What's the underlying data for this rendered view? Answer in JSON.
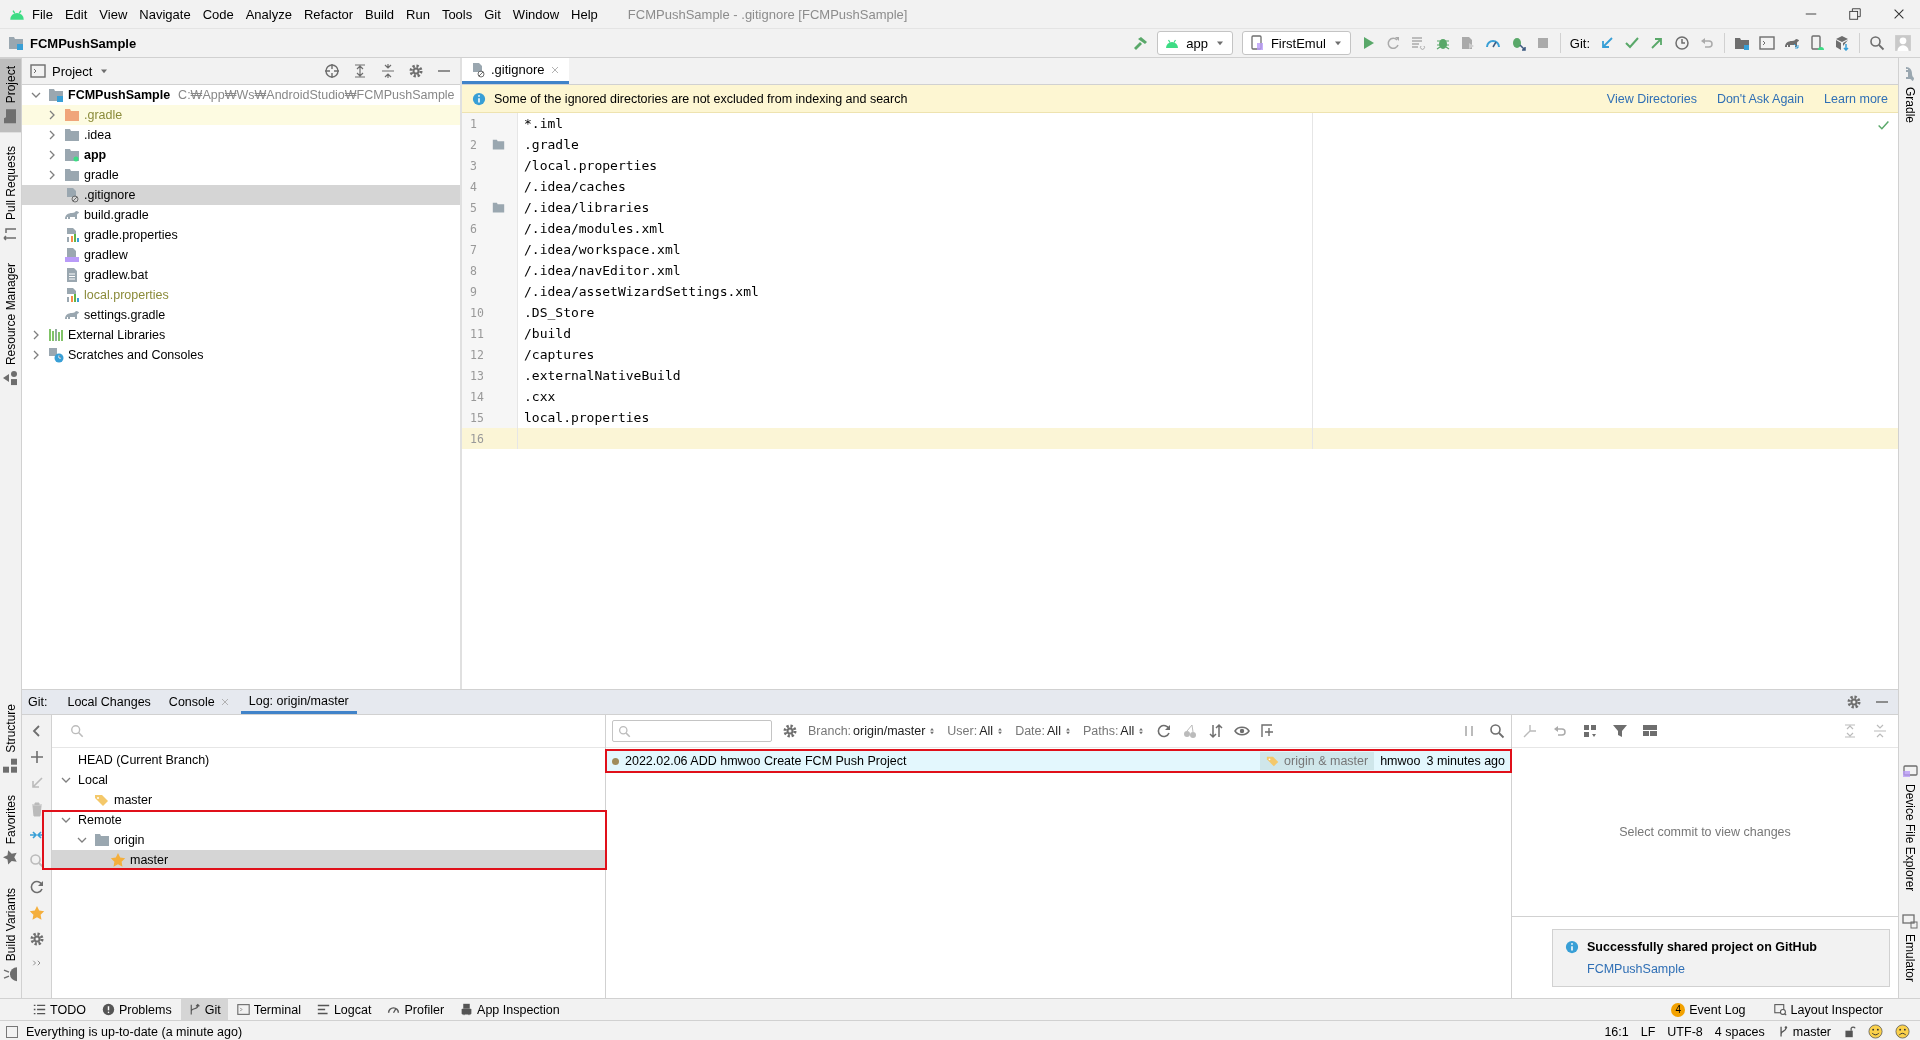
{
  "menu": {
    "items": [
      "File",
      "Edit",
      "View",
      "Navigate",
      "Code",
      "Analyze",
      "Refactor",
      "Build",
      "Run",
      "Tools",
      "Git",
      "Window",
      "Help"
    ],
    "title": "FCMPushSample - .gitignore [FCMPushSample]"
  },
  "navbar": {
    "project": "FCMPushSample",
    "run_config": "app",
    "device": "FirstEmul",
    "git_label": "Git:"
  },
  "left_strip": {
    "top": [
      {
        "label": "Project",
        "selected": true
      },
      {
        "label": "Pull Requests",
        "selected": false
      },
      {
        "label": "Resource Manager",
        "selected": false
      }
    ],
    "bottom": [
      {
        "label": "Structure",
        "selected": false
      },
      {
        "label": "Favorites",
        "selected": false
      },
      {
        "label": "Build Variants",
        "selected": false
      }
    ]
  },
  "right_strip": {
    "top": [
      {
        "label": "Gradle",
        "selected": false
      }
    ],
    "bottom": [
      {
        "label": "Device File Explorer",
        "selected": false
      },
      {
        "label": "Emulator",
        "selected": false
      }
    ]
  },
  "project_panel": {
    "title": "Project",
    "tree": [
      {
        "label": "FCMPushSample",
        "path": "C:₩App₩Ws₩AndroidStudio₩FCMPushSample",
        "kind": "project",
        "expanded": true,
        "selected": false,
        "ignored": false,
        "highlighted": false,
        "children": [
          {
            "label": ".gradle",
            "kind": "excluded-folder",
            "expanded": false,
            "selected": false,
            "ignored": true,
            "highlighted": true
          },
          {
            "label": ".idea",
            "kind": "folder",
            "expanded": false,
            "selected": false,
            "ignored": false,
            "highlighted": false
          },
          {
            "label": "app",
            "kind": "module",
            "expanded": false,
            "selected": false,
            "ignored": false,
            "highlighted": false
          },
          {
            "label": "gradle",
            "kind": "folder",
            "expanded": false,
            "selected": false,
            "ignored": false,
            "highlighted": false
          },
          {
            "label": ".gitignore",
            "kind": "ignore-file",
            "selected": true,
            "ignored": false,
            "highlighted": false
          },
          {
            "label": "build.gradle",
            "kind": "gradle",
            "selected": false,
            "ignored": false,
            "highlighted": false
          },
          {
            "label": "gradle.properties",
            "kind": "properties",
            "selected": false,
            "ignored": false,
            "highlighted": false
          },
          {
            "label": "gradlew",
            "kind": "shell",
            "selected": false,
            "ignored": false,
            "highlighted": false
          },
          {
            "label": "gradlew.bat",
            "kind": "text",
            "selected": false,
            "ignored": false,
            "highlighted": false
          },
          {
            "label": "local.properties",
            "kind": "properties",
            "selected": false,
            "ignored": true,
            "highlighted": false
          },
          {
            "label": "settings.gradle",
            "kind": "gradle",
            "selected": false,
            "ignored": false,
            "highlighted": false
          }
        ]
      },
      {
        "label": "External Libraries",
        "kind": "libraries",
        "expanded": false,
        "selected": false,
        "ignored": false,
        "highlighted": false
      },
      {
        "label": "Scratches and Consoles",
        "kind": "scratches",
        "expanded": false,
        "selected": false,
        "ignored": false,
        "highlighted": false
      }
    ]
  },
  "editor": {
    "tabs": [
      {
        "label": ".gitignore",
        "selected": true
      }
    ],
    "banner": {
      "message": "Some of the ignored directories are not excluded from indexing and search",
      "links": [
        "View Directories",
        "Don't Ask Again",
        "Learn more"
      ]
    },
    "lines": [
      {
        "number": "1",
        "text": "*.iml",
        "marker": false,
        "current": false
      },
      {
        "number": "2",
        "text": ".gradle",
        "marker": true,
        "current": false
      },
      {
        "number": "3",
        "text": "/local.properties",
        "marker": false,
        "current": false
      },
      {
        "number": "4",
        "text": "/.idea/caches",
        "marker": false,
        "current": false
      },
      {
        "number": "5",
        "text": "/.idea/libraries",
        "marker": true,
        "current": false
      },
      {
        "number": "6",
        "text": "/.idea/modules.xml",
        "marker": false,
        "current": false
      },
      {
        "number": "7",
        "text": "/.idea/workspace.xml",
        "marker": false,
        "current": false
      },
      {
        "number": "8",
        "text": "/.idea/navEditor.xml",
        "marker": false,
        "current": false
      },
      {
        "number": "9",
        "text": "/.idea/assetWizardSettings.xml",
        "marker": false,
        "current": false
      },
      {
        "number": "10",
        "text": ".DS_Store",
        "marker": false,
        "current": false
      },
      {
        "number": "11",
        "text": "/build",
        "marker": false,
        "current": false
      },
      {
        "number": "12",
        "text": "/captures",
        "marker": false,
        "current": false
      },
      {
        "number": "13",
        "text": ".externalNativeBuild",
        "marker": false,
        "current": false
      },
      {
        "number": "14",
        "text": ".cxx",
        "marker": false,
        "current": false
      },
      {
        "number": "15",
        "text": "local.properties",
        "marker": false,
        "current": false
      },
      {
        "number": "16",
        "marker": false,
        "current": true
      }
    ]
  },
  "git_panel": {
    "label": "Git:",
    "tabs": [
      {
        "label": "Local Changes",
        "closable": false,
        "selected": false
      },
      {
        "label": "Console",
        "closable": true,
        "selected": false
      },
      {
        "label": "Log: origin/master",
        "closable": false,
        "selected": true
      }
    ],
    "branches": [
      {
        "label": "HEAD (Current Branch)",
        "selected": false,
        "annotated": false
      },
      {
        "label": "Local",
        "expanded": true,
        "selected": false,
        "annotated": false,
        "children": [
          {
            "label": "master",
            "kind": "local-branch",
            "selected": false
          }
        ]
      },
      {
        "label": "Remote",
        "expanded": true,
        "selected": false,
        "annotated": true,
        "children": [
          {
            "label": "origin",
            "kind": "remote",
            "expanded": true,
            "selected": false,
            "children": [
              {
                "label": "master",
                "kind": "favorite-branch",
                "selected": true
              }
            ]
          }
        ]
      }
    ],
    "filters": [
      {
        "label": "Branch:",
        "value": "origin/master"
      },
      {
        "label": "User:",
        "value": "All"
      },
      {
        "label": "Date:",
        "value": "All"
      },
      {
        "label": "Paths:",
        "value": "All"
      }
    ],
    "commits": [
      {
        "subject": "2022.02.06 ADD hmwoo Create FCM Push Project",
        "refs": "origin & master",
        "author": "hmwoo",
        "time": "3 minutes ago",
        "color": "#a08c5a",
        "selected": true,
        "annotated": true
      }
    ],
    "changes_empty": "Select commit to view changes",
    "notification": {
      "title": "Successfully shared project on GitHub",
      "link": "FCMPushSample"
    }
  },
  "tool_buttons": {
    "left": [
      {
        "label": "TODO",
        "kind": "todo",
        "selected": false
      },
      {
        "label": "Problems",
        "kind": "problems",
        "selected": false
      },
      {
        "label": "Git",
        "kind": "git",
        "selected": true
      },
      {
        "label": "Terminal",
        "kind": "terminal",
        "selected": false
      },
      {
        "label": "Logcat",
        "kind": "logcat",
        "selected": false
      },
      {
        "label": "Profiler",
        "kind": "profiler",
        "selected": false
      },
      {
        "label": "App Inspection",
        "kind": "inspection",
        "selected": false
      }
    ],
    "right": [
      {
        "label": "Event Log",
        "kind": "event-log",
        "badge": "4"
      },
      {
        "label": "Layout Inspector",
        "kind": "layout-inspector"
      }
    ]
  },
  "status": {
    "message": "Everything is up-to-date (a minute ago)",
    "position": "16:1",
    "line_separator": "LF",
    "encoding": "UTF-8",
    "indent": "4 spaces",
    "branch": "master"
  }
}
